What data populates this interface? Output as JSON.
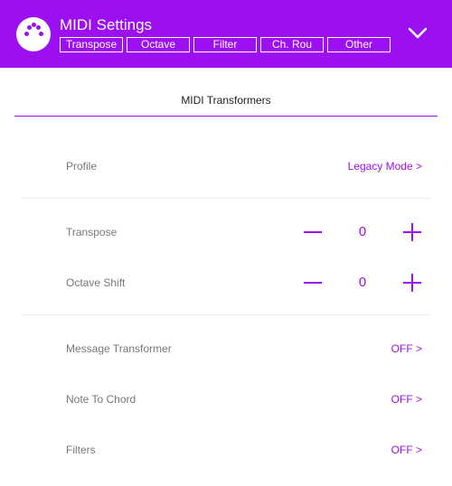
{
  "header": {
    "title": "MIDI Settings",
    "tabs": [
      "Transpose",
      "Octave",
      "Filter",
      "Ch. Rou",
      "Other"
    ]
  },
  "section": {
    "title": "MIDI Transformers"
  },
  "rows": {
    "profile": {
      "label": "Profile",
      "value": "Legacy Mode >"
    },
    "transpose": {
      "label": "Transpose",
      "value": "0"
    },
    "octave_shift": {
      "label": "Octave Shift",
      "value": "0"
    },
    "message_transformer": {
      "label": "Message Transformer",
      "value": "OFF >"
    },
    "note_to_chord": {
      "label": "Note To Chord",
      "value": "OFF >"
    },
    "filters": {
      "label": "Filters",
      "value": "OFF >"
    }
  },
  "icons": {
    "logo": "midi-connector-icon",
    "collapse": "chevron-down-icon",
    "decrement": "minus-icon",
    "increment": "plus-icon"
  },
  "colors": {
    "accent": "#9c0ff0",
    "header_text": "#ffffff",
    "label": "#777777"
  }
}
